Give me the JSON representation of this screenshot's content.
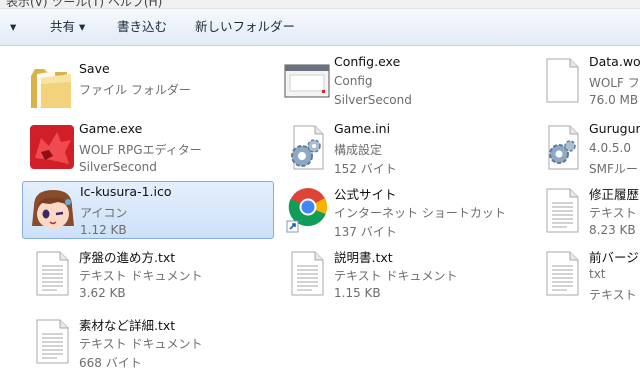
{
  "menubar": {
    "text": "表示(V)   ツール(T)   ヘルプ(H)"
  },
  "toolbar": {
    "organize_arrow": "▾",
    "share_label": "共有 ▾",
    "burn_label": "書き込む",
    "new_folder_label": "新しいフォルダー"
  },
  "files": [
    {
      "name": "Save",
      "line1": "ファイル フォルダー",
      "line2": "",
      "icon": "folder-icon"
    },
    {
      "name": "Game.exe",
      "line1": "WOLF RPGエディター",
      "line2": "SilverSecond",
      "icon": "wolf-rpg-icon"
    },
    {
      "name": "Ic-kusura-1.ico",
      "line1": "アイコン",
      "line2": "1.12 KB",
      "icon": "anime-face-icon",
      "selected": true
    },
    {
      "name": "序盤の進め方.txt",
      "line1": "テキスト ドキュメント",
      "line2": "3.62 KB",
      "icon": "text-document-icon"
    },
    {
      "name": "素材など詳細.txt",
      "line1": "テキスト ドキュメント",
      "line2": "668 バイト",
      "icon": "text-document-icon"
    },
    {
      "name": "Config.exe",
      "line1": "Config",
      "line2": "SilverSecond",
      "icon": "application-window-icon"
    },
    {
      "name": "Game.ini",
      "line1": "構成設定",
      "line2": "152 バイト",
      "icon": "settings-file-icon"
    },
    {
      "name": "公式サイト",
      "line1": "インターネット ショートカット",
      "line2": "137 バイト",
      "icon": "chrome-shortcut-icon"
    },
    {
      "name": "説明書.txt",
      "line1": "テキスト ドキュメント",
      "line2": "1.15 KB",
      "icon": "text-document-icon"
    },
    {
      "name": "Data.wolf",
      "line1": "WOLF ファ",
      "line2": "76.0 MB",
      "icon": "blank-file-icon"
    },
    {
      "name": "Guruguru",
      "line1": "4.0.5.0",
      "line2": "SMFルー",
      "icon": "settings-file-icon"
    },
    {
      "name": "修正履歴.",
      "line1": "テキスト",
      "line2": "8.23 KB",
      "icon": "text-document-icon"
    },
    {
      "name": "前バージョ",
      "line1": "txt",
      "line2": "テキスト",
      "icon": "text-document-icon"
    }
  ]
}
